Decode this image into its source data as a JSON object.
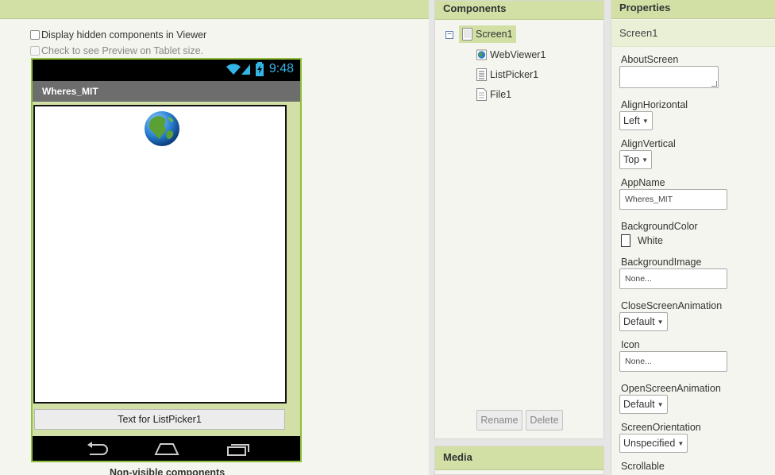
{
  "viewer": {
    "display_hidden_label": "Display hidden components in Viewer",
    "tablet_preview_label": "Check to see Preview on Tablet size.",
    "status_time": "9:48",
    "screen_title": "Wheres_MIT",
    "listpicker_text": "Text for ListPicker1",
    "nonvisible_label": "Non-visible components"
  },
  "components": {
    "header": "Components",
    "tree": [
      {
        "label": "Screen1",
        "icon": "screen-icon",
        "selected": true
      },
      {
        "label": "WebViewer1",
        "icon": "webviewer-icon"
      },
      {
        "label": "ListPicker1",
        "icon": "listpicker-icon"
      },
      {
        "label": "File1",
        "icon": "file-icon"
      }
    ],
    "rename_label": "Rename",
    "delete_label": "Delete",
    "media_header": "Media"
  },
  "properties": {
    "header": "Properties",
    "component_name": "Screen1",
    "about_screen": {
      "label": "AboutScreen",
      "value": ""
    },
    "align_horizontal": {
      "label": "AlignHorizontal",
      "value": "Left"
    },
    "align_vertical": {
      "label": "AlignVertical",
      "value": "Top"
    },
    "app_name": {
      "label": "AppName",
      "value": "Wheres_MIT"
    },
    "background_color": {
      "label": "BackgroundColor",
      "value": "White",
      "swatch": "#ffffff"
    },
    "background_image": {
      "label": "BackgroundImage",
      "value": "None..."
    },
    "close_screen_animation": {
      "label": "CloseScreenAnimation",
      "value": "Default"
    },
    "icon": {
      "label": "Icon",
      "value": "None..."
    },
    "open_screen_animation": {
      "label": "OpenScreenAnimation",
      "value": "Default"
    },
    "screen_orientation": {
      "label": "ScreenOrientation",
      "value": "Unspecified"
    },
    "scrollable": {
      "label": "Scrollable"
    }
  },
  "colors": {
    "header_green": "#d2e0a6",
    "phone_border": "#8fbf3a",
    "status_blue": "#33b5e5"
  }
}
